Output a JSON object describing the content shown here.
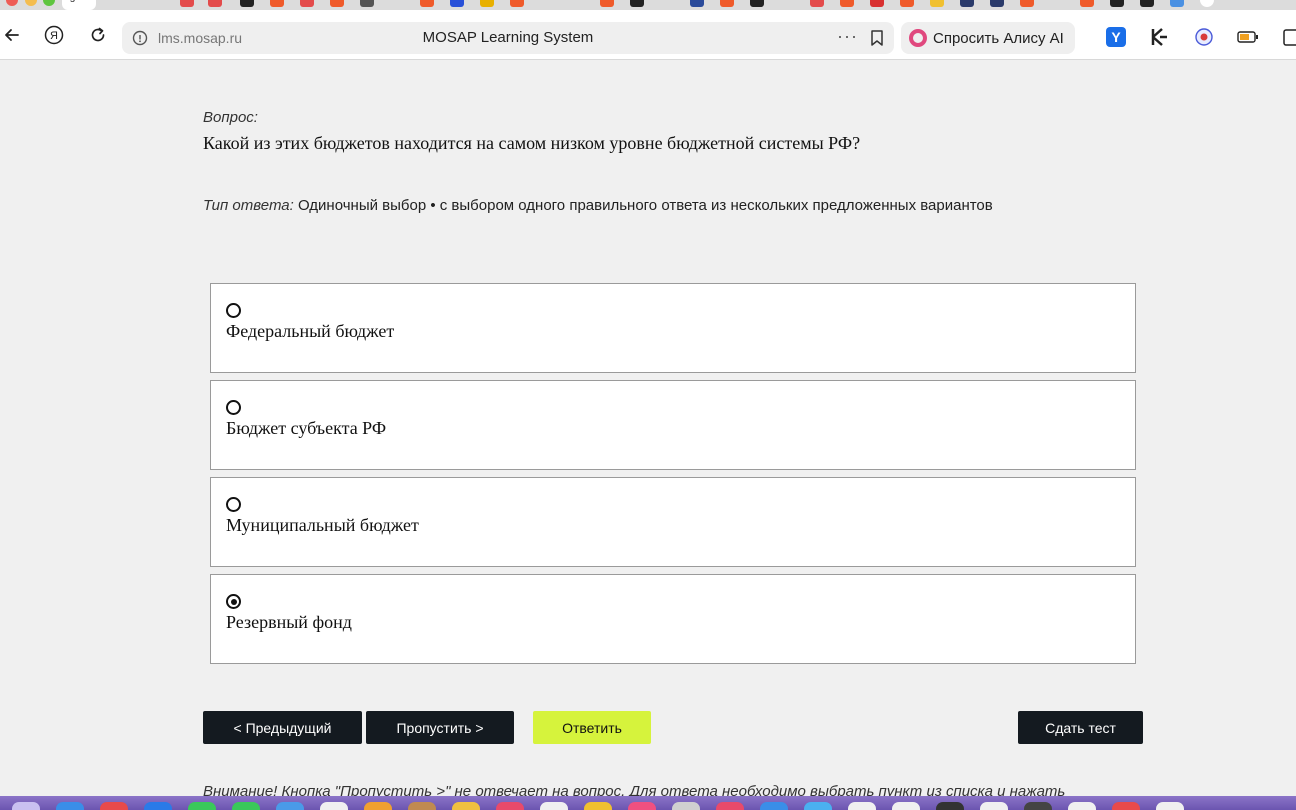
{
  "browser": {
    "tab_label": "з",
    "url_host": "lms.mosap.ru",
    "page_title": "MOSAP Learning System",
    "more_label": "···",
    "alice_label": "Спросить Алису AI"
  },
  "question": {
    "caption": "Вопрос:",
    "text": "Какой из этих бюджетов находится на самом низком уровне бюджетной системы РФ?"
  },
  "answer_type": {
    "label": "Тип ответа:",
    "value": "Одиночный выбор • с выбором одного правильного ответа из нескольких предложенных вариантов"
  },
  "options": [
    {
      "label": "Федеральный бюджет",
      "checked": false
    },
    {
      "label": "Бюджет субъекта РФ",
      "checked": false
    },
    {
      "label": "Муниципальный бюджет",
      "checked": false
    },
    {
      "label": "Резервный фонд",
      "checked": true
    }
  ],
  "buttons": {
    "previous": "< Предыдущий",
    "skip": "Пропустить >",
    "answer": "Ответить",
    "submit": "Сдать тест"
  },
  "notice": "Внимание! Кнопка \"Пропустить >\" не отвечает на вопрос. Для ответа необходимо выбрать пункт из списка и нажать",
  "colors": {
    "accent": "#d6f33c",
    "dark_button": "#141a20",
    "page_bg": "#f0f0f0"
  }
}
